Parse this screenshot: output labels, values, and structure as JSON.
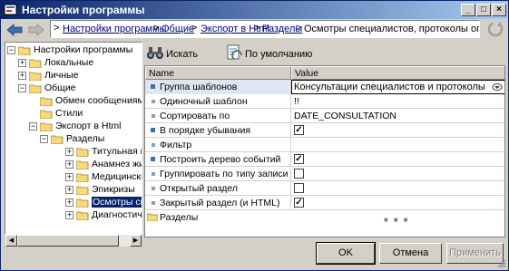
{
  "window": {
    "title": "Настройки программы"
  },
  "path": {
    "crumbs": [
      {
        "label": "Настройки программы",
        "link": true
      },
      {
        "label": "Общие",
        "link": true
      },
      {
        "label": "Экспорт в Html",
        "link": true
      },
      {
        "label": "Разделы",
        "link": true
      },
      {
        "label": "Осмотры специалистов, протоколы операций",
        "link": false
      }
    ],
    "separator": ">"
  },
  "tree": {
    "items": [
      {
        "label": "Настройки программы",
        "box": "−"
      },
      {
        "label": "Локальные",
        "box": "+"
      },
      {
        "label": "Личные",
        "box": "+"
      },
      {
        "label": "Общие",
        "box": "−"
      },
      {
        "label": "Обмен сообщениями",
        "box": ""
      },
      {
        "label": "Стили",
        "box": ""
      },
      {
        "label": "Экспорт в Html",
        "box": "−"
      },
      {
        "label": "Разделы",
        "box": "−"
      },
      {
        "label": "Титульная ин",
        "box": "+"
      },
      {
        "label": "Анамнез жиз",
        "box": "+"
      },
      {
        "label": "Медицинский",
        "box": "+"
      },
      {
        "label": "Эпикризы",
        "box": "+"
      },
      {
        "label": "Осмотры спе",
        "box": "+",
        "selected": true
      },
      {
        "label": "Диагностиче",
        "box": "+"
      }
    ]
  },
  "toolbar": {
    "search_label": "Искать",
    "default_label": "По умолчанию"
  },
  "grid": {
    "headers": {
      "name": "Name",
      "value": "Value"
    },
    "rows": [
      {
        "name": "Группа шаблонов",
        "kind": "combo",
        "value": "Консультации специалистов и протоколы опер",
        "plus": true
      },
      {
        "name": "Одиночный шаблон",
        "kind": "text",
        "value": "!!"
      },
      {
        "name": "Сортировать по",
        "kind": "text",
        "value": "DATE_CONSULTATION"
      },
      {
        "name": "В порядке убывания",
        "kind": "check",
        "checked": true,
        "plus": true
      },
      {
        "name": "Фильтр",
        "kind": "text",
        "value": ""
      },
      {
        "name": "Построить дерево событий",
        "kind": "check",
        "checked": true,
        "plus": true
      },
      {
        "name": "Группировать по типу записи",
        "kind": "check",
        "checked": false
      },
      {
        "name": "Открытый раздел",
        "kind": "check",
        "checked": false
      },
      {
        "name": "Закрытый раздел (и HTML)",
        "kind": "check",
        "checked": true
      },
      {
        "name": "Разделы",
        "kind": "group"
      }
    ]
  },
  "buttons": {
    "ok": "OK",
    "cancel": "Отмена",
    "apply": "Применить"
  },
  "colors": {
    "titlebar_start": "#0a246a",
    "titlebar_end": "#a6caf0",
    "selection": "#0a246a",
    "link": "#00007f"
  }
}
